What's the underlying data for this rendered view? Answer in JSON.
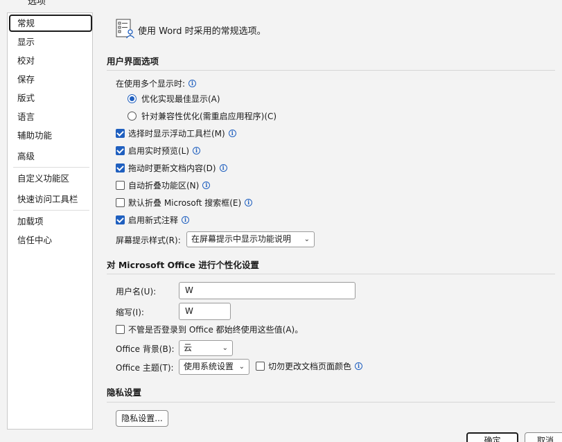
{
  "title_remnant": "选项",
  "sidebar": {
    "items": [
      {
        "label": "常规"
      },
      {
        "label": "显示"
      },
      {
        "label": "校对"
      },
      {
        "label": "保存"
      },
      {
        "label": "版式"
      },
      {
        "label": "语言"
      },
      {
        "label": "辅助功能"
      },
      {
        "label": "高级"
      },
      {
        "label": "自定义功能区"
      },
      {
        "label": "快速访问工具栏"
      },
      {
        "label": "加载项"
      },
      {
        "label": "信任中心"
      }
    ]
  },
  "intro": {
    "text": "使用 Word 时采用的常规选项。"
  },
  "ui_section": {
    "heading": "用户界面选项",
    "multi_display_label": "在使用多个显示时:",
    "radio_best": "优化实现最佳显示(A)",
    "radio_compat": "针对兼容性优化(需重启应用程序)(C)",
    "cb_minitoolbar": "选择时显示浮动工具栏(M)",
    "cb_livepreview": "启用实时预览(L)",
    "cb_dragupdate": "拖动时更新文档内容(D)",
    "cb_collapse_ribbon": "自动折叠功能区(N)",
    "cb_collapse_search": "默认折叠 Microsoft 搜索框(E)",
    "cb_modern_comments": "启用新式注释",
    "screentip_label": "屏幕提示样式(R):",
    "screentip_value": "在屏幕提示中显示功能说明"
  },
  "personalize_section": {
    "heading": "对 Microsoft Office 进行个性化设置",
    "username_label": "用户名(U):",
    "username_value": "W",
    "initials_label": "缩写(I):",
    "initials_value": "W",
    "always_use_label": "不管是否登录到 Office 都始终使用这些值(A)。",
    "background_label": "Office 背景(B):",
    "background_value": "云",
    "theme_label": "Office 主题(T):",
    "theme_value": "使用系统设置",
    "never_change_page_color": "切勿更改文档页面颜色"
  },
  "privacy_section": {
    "heading": "隐私设置",
    "button": "隐私设置..."
  },
  "footer": {
    "ok": "确定",
    "cancel": "取消"
  },
  "colors": {
    "accent": "#1f5fbf",
    "panel": "#f3f3f3"
  }
}
